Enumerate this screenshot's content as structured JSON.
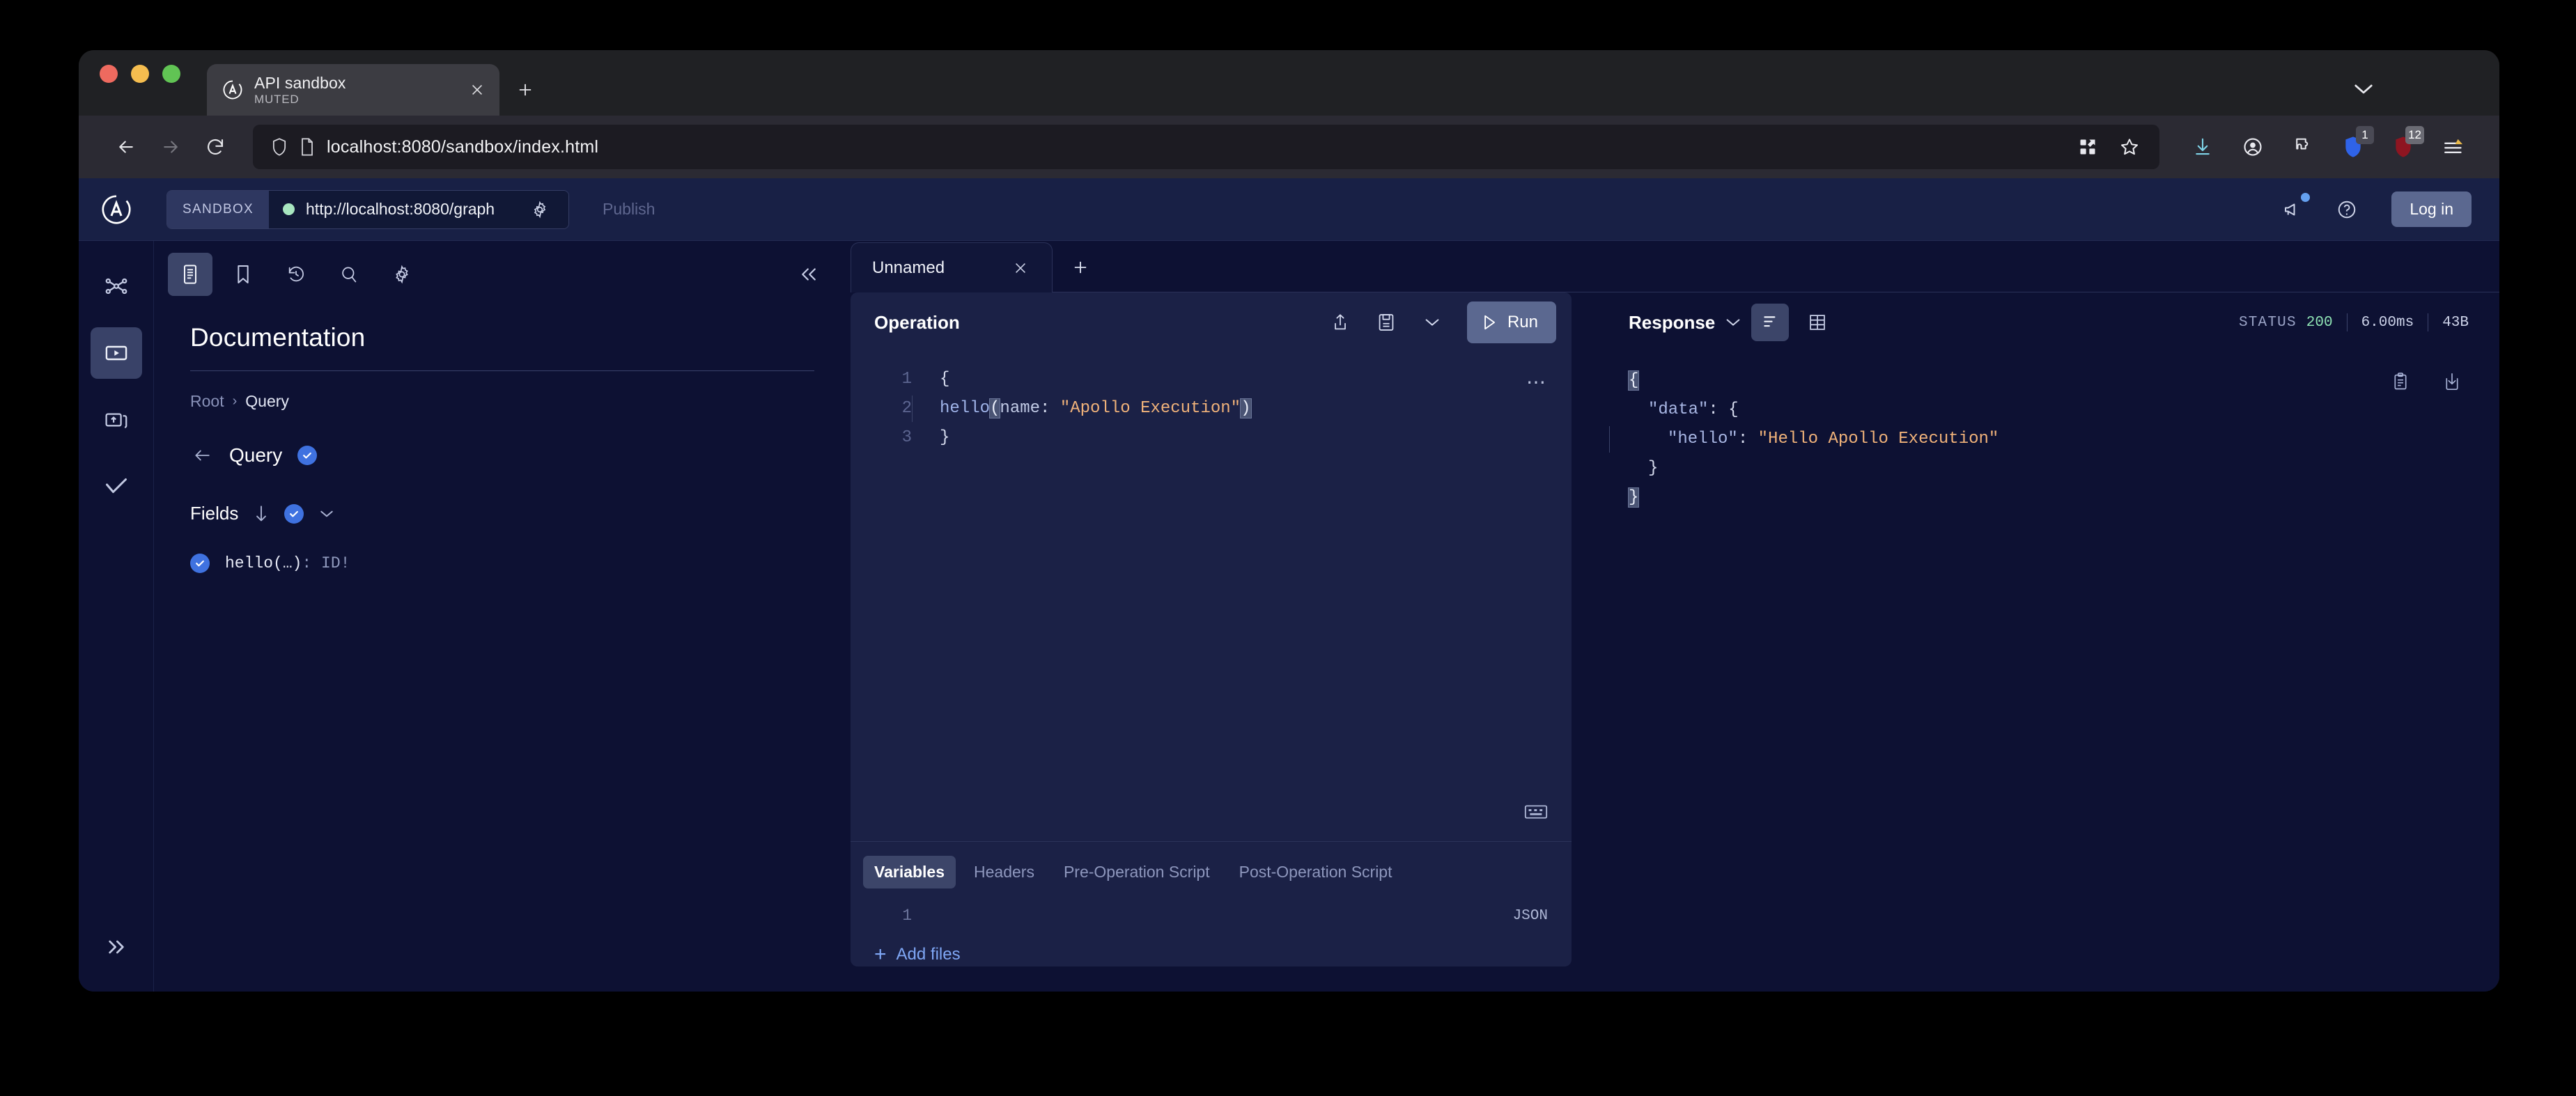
{
  "browser": {
    "tab": {
      "title": "API sandbox",
      "subtitle": "MUTED",
      "favicon_icon": "apollo-logo-icon",
      "close_icon": "close-icon"
    },
    "new_tab_icon": "plus-icon",
    "window_chevron_icon": "chevron-down-icon",
    "nav": {
      "back_icon": "arrow-left-icon",
      "forward_icon": "arrow-right-icon",
      "reload_icon": "reload-icon"
    },
    "url_bar": {
      "value": "localhost:8080/sandbox/index.html",
      "shield_icon": "shield-icon",
      "page_icon": "page-icon",
      "extensions_icon": "extensions-grid-icon",
      "bookmark_icon": "star-icon"
    },
    "toolbar_icons": [
      {
        "name": "downloads-icon",
        "badge": null
      },
      {
        "name": "account-icon",
        "badge": null
      },
      {
        "name": "extension-puzzle-icon",
        "badge": null
      },
      {
        "name": "shield-blue-icon",
        "badge": "1"
      },
      {
        "name": "shield-red-icon",
        "badge": "12"
      },
      {
        "name": "app-menu-icon",
        "badge": null
      }
    ]
  },
  "apollo": {
    "header": {
      "logo_icon": "apollo-logo-icon",
      "sandbox_chip": "SANDBOX",
      "endpoint_url": "http://localhost:8080/graph",
      "endpoint_gear_icon": "gear-icon",
      "publish_label": "Publish",
      "announcement_icon": "megaphone-icon",
      "help_icon": "help-circle-icon",
      "login_label": "Log in"
    },
    "rail": [
      {
        "name": "sidebar-item-schema",
        "icon": "schema-graph-icon",
        "active": false
      },
      {
        "name": "sidebar-item-explorer",
        "icon": "explorer-play-icon",
        "active": true
      },
      {
        "name": "sidebar-item-variants",
        "icon": "stack-cards-icon",
        "active": false
      },
      {
        "name": "sidebar-item-checks",
        "icon": "check-icon",
        "active": false
      }
    ],
    "rail_expand_icon": "chevron-double-right-icon",
    "docs": {
      "tabs": [
        {
          "name": "docs-tab-documentation",
          "icon": "document-list-icon",
          "active": true
        },
        {
          "name": "docs-tab-saved",
          "icon": "bookmark-icon",
          "active": false
        },
        {
          "name": "docs-tab-history",
          "icon": "history-icon",
          "active": false
        },
        {
          "name": "docs-tab-search",
          "icon": "search-icon",
          "active": false
        },
        {
          "name": "docs-tab-settings",
          "icon": "gear-icon",
          "active": false
        }
      ],
      "collapse_icon": "chevron-double-left-icon",
      "title": "Documentation",
      "breadcrumb": {
        "root": "Root",
        "separator": "›",
        "current": "Query"
      },
      "type_row": {
        "back_icon": "arrow-left-icon",
        "name": "Query",
        "badge_icon": "check-circle-icon"
      },
      "fields_row": {
        "label": "Fields",
        "sort_icon": "arrow-down-icon",
        "badge_icon": "check-circle-icon",
        "collapse_icon": "chevron-down-icon"
      },
      "fields": [
        {
          "badge_icon": "check-circle-icon",
          "name": "hello(…)",
          "separator": ": ",
          "type": "ID!"
        }
      ]
    },
    "operation_tabs": {
      "tab_label": "Unnamed",
      "close_icon": "close-icon",
      "add_icon": "plus-icon"
    },
    "operation": {
      "title": "Operation",
      "share_icon": "share-up-icon",
      "save_icon": "floppy-save-icon",
      "menu_icon": "chevron-down-icon",
      "run_label": "Run",
      "run_icon": "play-triangle-icon",
      "more_icon": "more-dots-icon",
      "keyboard_icon": "keyboard-icon",
      "code_lines": [
        {
          "num": "1",
          "parts": [
            {
              "t": "{",
              "c": "punc"
            }
          ]
        },
        {
          "num": "2",
          "indent": true,
          "parts": [
            {
              "t": "hello",
              "c": "field"
            },
            {
              "t": "(",
              "c": "bracket-hl"
            },
            {
              "t": "name",
              "c": "arg"
            },
            {
              "t": ": ",
              "c": "punc"
            },
            {
              "t": "\"Apollo Execution\"",
              "c": "str"
            },
            {
              "t": ")",
              "c": "bracket-hl"
            }
          ]
        },
        {
          "num": "3",
          "parts": [
            {
              "t": "}",
              "c": "punc"
            }
          ]
        }
      ]
    },
    "operation_bottom": {
      "tabs": [
        {
          "label": "Variables",
          "active": true
        },
        {
          "label": "Headers",
          "active": false
        },
        {
          "label": "Pre-Operation Script",
          "active": false
        },
        {
          "label": "Post-Operation Script",
          "active": false
        }
      ],
      "line_number": "1",
      "language": "JSON",
      "add_files_label": "Add files",
      "add_files_plus": "+"
    },
    "response": {
      "title": "Response",
      "chevron_icon": "chevron-down-icon",
      "view_json_icon": "json-lines-icon",
      "view_table_icon": "table-grid-icon",
      "status_label": "STATUS",
      "status_code": "200",
      "duration": "6.00ms",
      "size": "43B",
      "copy_icon": "clipboard-copy-icon",
      "download_icon": "download-box-icon",
      "body_lines": [
        {
          "parts": [
            {
              "t": "{",
              "c": "bracket-hl"
            }
          ]
        },
        {
          "indent": 1,
          "parts": [
            {
              "t": "\"data\"",
              "c": "key"
            },
            {
              "t": ": {",
              "c": "punc"
            }
          ]
        },
        {
          "indent": 2,
          "guide": true,
          "parts": [
            {
              "t": "\"hello\"",
              "c": "key"
            },
            {
              "t": ": ",
              "c": "punc"
            },
            {
              "t": "\"Hello Apollo Execution\"",
              "c": "str"
            }
          ]
        },
        {
          "indent": 1,
          "parts": [
            {
              "t": "}",
              "c": "punc"
            }
          ]
        },
        {
          "parts": [
            {
              "t": "}",
              "c": "bracket-hl"
            }
          ]
        }
      ]
    }
  }
}
